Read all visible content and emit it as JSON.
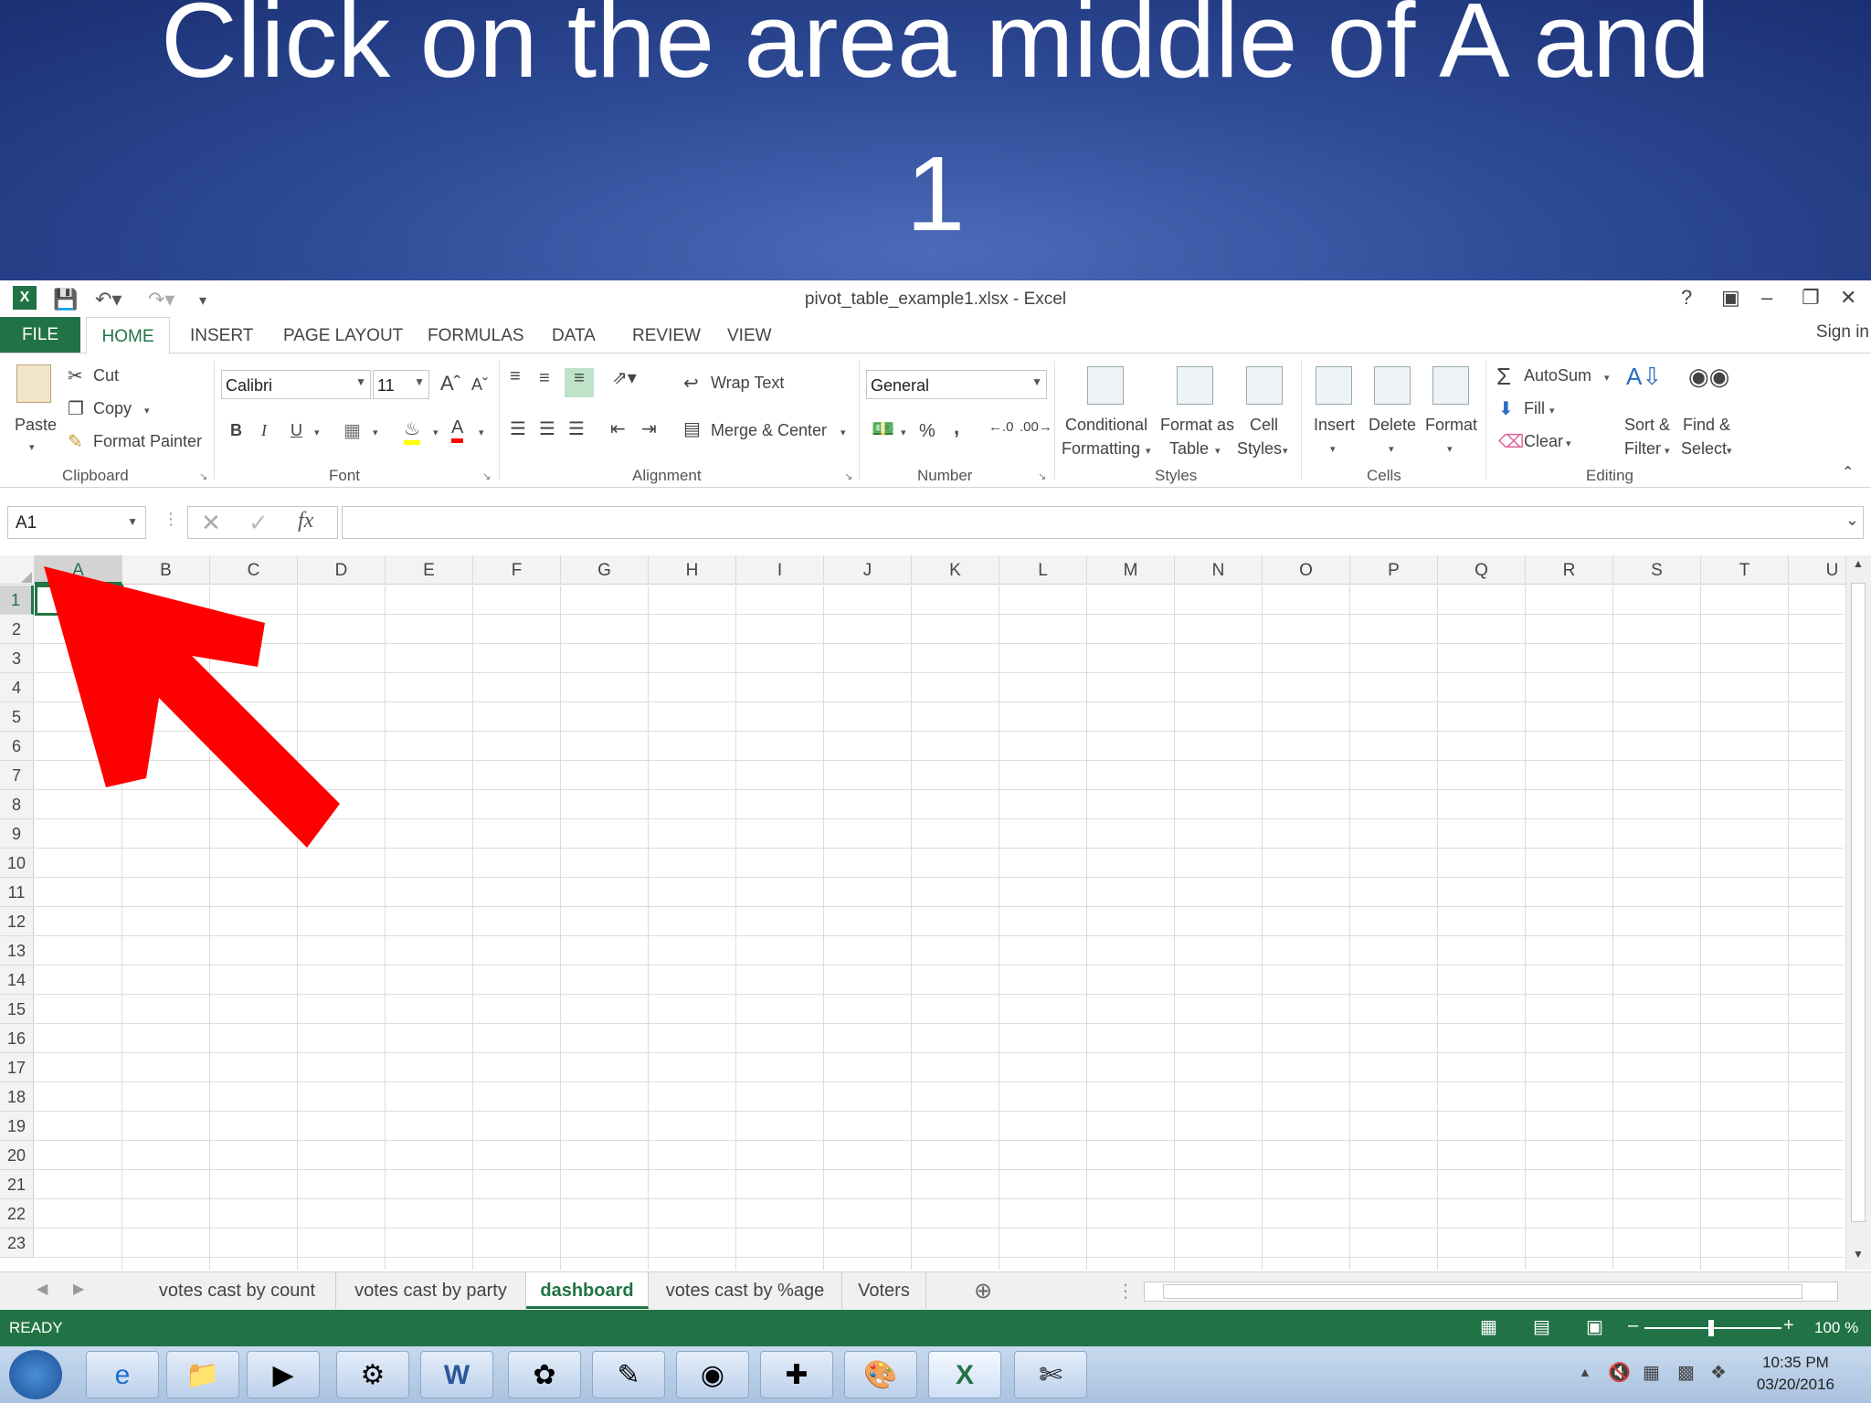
{
  "banner": {
    "line1": "Click on the area middle of A and",
    "line2": "1"
  },
  "window": {
    "title": "pivot_table_example1.xlsx - Excel",
    "help": "?",
    "sign_in": "Sign in"
  },
  "ribbon_tabs": [
    "FILE",
    "HOME",
    "INSERT",
    "PAGE LAYOUT",
    "FORMULAS",
    "DATA",
    "REVIEW",
    "VIEW"
  ],
  "ribbon": {
    "clipboard": {
      "paste": "Paste",
      "cut": "Cut",
      "copy": "Copy",
      "format_painter": "Format Painter",
      "group": "Clipboard"
    },
    "font": {
      "name": "Calibri",
      "size": "11",
      "bold": "B",
      "italic": "I",
      "underline": "U",
      "group": "Font"
    },
    "alignment": {
      "wrap_text": "Wrap Text",
      "merge_center": "Merge & Center",
      "group": "Alignment"
    },
    "number": {
      "format": "General",
      "percent": "%",
      "comma": ",",
      "group": "Number"
    },
    "styles": {
      "conditional": "Conditional",
      "formatting": "Formatting",
      "format_as": "Format as",
      "table": "Table",
      "cell": "Cell",
      "cell_styles": "Styles",
      "group": "Styles"
    },
    "cells": {
      "insert": "Insert",
      "delete": "Delete",
      "format": "Format",
      "group": "Cells"
    },
    "editing": {
      "autosum": "AutoSum",
      "fill": "Fill",
      "clear": "Clear",
      "sort": "Sort &",
      "filter": "Filter",
      "find": "Find &",
      "select": "Select",
      "group": "Editing"
    }
  },
  "formula_bar": {
    "name_box": "A1",
    "fx": "fx",
    "value": ""
  },
  "columns": [
    "A",
    "B",
    "C",
    "D",
    "E",
    "F",
    "G",
    "H",
    "I",
    "J",
    "K",
    "L",
    "M",
    "N",
    "O",
    "P",
    "Q",
    "R",
    "S",
    "T",
    "U"
  ],
  "rows": [
    "1",
    "2",
    "3",
    "4",
    "5",
    "6",
    "7",
    "8",
    "9",
    "10",
    "11",
    "12",
    "13",
    "14",
    "15",
    "16",
    "17",
    "18",
    "19",
    "20",
    "21",
    "22",
    "23"
  ],
  "sheets": [
    "votes cast by count",
    "votes cast by party",
    "dashboard",
    "votes cast by %age",
    "Voters"
  ],
  "active_sheet": "dashboard",
  "status": {
    "mode": "READY",
    "zoom": "100 %"
  },
  "taskbar": {
    "time": "10:35 PM",
    "date": "03/20/2016"
  },
  "colors": {
    "excel_green": "#217346",
    "arrow_red": "#ff0000",
    "banner_blue": "#2f4c98"
  }
}
